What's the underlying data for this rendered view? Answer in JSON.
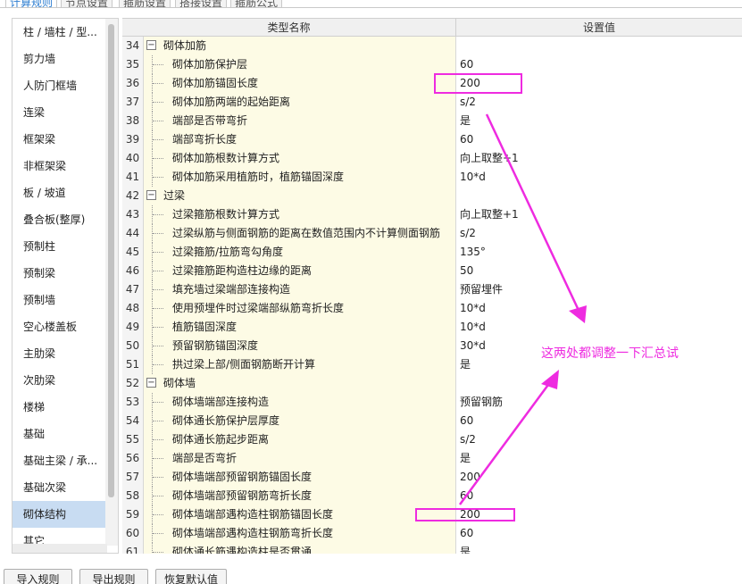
{
  "tabs": [
    {
      "label": "计算规则",
      "active": true
    },
    {
      "label": "节点设置",
      "active": false
    },
    {
      "label": "箍筋设置",
      "active": false
    },
    {
      "label": "搭接设置",
      "active": false
    },
    {
      "label": "箍筋公式",
      "active": false
    }
  ],
  "sidebar": {
    "items": [
      {
        "label": "柱 / 墙柱 / 型..."
      },
      {
        "label": "剪力墙"
      },
      {
        "label": "人防门框墙"
      },
      {
        "label": "连梁"
      },
      {
        "label": "框架梁"
      },
      {
        "label": "非框架梁"
      },
      {
        "label": "板 / 坡道"
      },
      {
        "label": "叠合板(整厚)"
      },
      {
        "label": "预制柱"
      },
      {
        "label": "预制梁"
      },
      {
        "label": "预制墙"
      },
      {
        "label": "空心楼盖板"
      },
      {
        "label": "主肋梁"
      },
      {
        "label": "次肋梁"
      },
      {
        "label": "楼梯"
      },
      {
        "label": "基础"
      },
      {
        "label": "基础主梁 / 承..."
      },
      {
        "label": "基础次梁"
      },
      {
        "label": "砌体结构",
        "selected": true
      },
      {
        "label": "其它"
      }
    ]
  },
  "grid": {
    "header": {
      "name": "类型名称",
      "value": "设置值"
    },
    "rows": [
      {
        "num": "34",
        "name": "砌体加筋",
        "value": "",
        "group": true,
        "toggle": "−"
      },
      {
        "num": "35",
        "name": "砌体加筋保护层",
        "value": "60"
      },
      {
        "num": "36",
        "name": "砌体加筋锚固长度",
        "value": "200"
      },
      {
        "num": "37",
        "name": "砌体加筋两端的起始距离",
        "value": "s/2"
      },
      {
        "num": "38",
        "name": "端部是否带弯折",
        "value": "是"
      },
      {
        "num": "39",
        "name": "端部弯折长度",
        "value": "60"
      },
      {
        "num": "40",
        "name": "砌体加筋根数计算方式",
        "value": "向上取整+1"
      },
      {
        "num": "41",
        "name": "砌体加筋采用植筋时，植筋锚固深度",
        "value": "10*d"
      },
      {
        "num": "42",
        "name": "过梁",
        "value": "",
        "group": true,
        "toggle": "−"
      },
      {
        "num": "43",
        "name": "过梁箍筋根数计算方式",
        "value": "向上取整+1"
      },
      {
        "num": "44",
        "name": "过梁纵筋与侧面钢筋的距离在数值范围内不计算侧面钢筋",
        "value": "s/2"
      },
      {
        "num": "45",
        "name": "过梁箍筋/拉筋弯勾角度",
        "value": "135°"
      },
      {
        "num": "46",
        "name": "过梁箍筋距构造柱边缘的距离",
        "value": "50"
      },
      {
        "num": "47",
        "name": "填充墙过梁端部连接构造",
        "value": "预留埋件"
      },
      {
        "num": "48",
        "name": "使用预埋件时过梁端部纵筋弯折长度",
        "value": "10*d"
      },
      {
        "num": "49",
        "name": "植筋锚固深度",
        "value": "10*d"
      },
      {
        "num": "50",
        "name": "预留钢筋锚固深度",
        "value": "30*d"
      },
      {
        "num": "51",
        "name": "拱过梁上部/侧面钢筋断开计算",
        "value": "是"
      },
      {
        "num": "52",
        "name": "砌体墙",
        "value": "",
        "group": true,
        "toggle": "−"
      },
      {
        "num": "53",
        "name": "砌体墙端部连接构造",
        "value": "预留钢筋"
      },
      {
        "num": "54",
        "name": "砌体通长筋保护层厚度",
        "value": "60"
      },
      {
        "num": "55",
        "name": "砌体通长筋起步距离",
        "value": "s/2"
      },
      {
        "num": "56",
        "name": "端部是否弯折",
        "value": "是"
      },
      {
        "num": "57",
        "name": "砌体墙端部预留钢筋锚固长度",
        "value": "200"
      },
      {
        "num": "58",
        "name": "砌体墙端部预留钢筋弯折长度",
        "value": "60"
      },
      {
        "num": "59",
        "name": "砌体墙端部遇构造柱钢筋锚固长度",
        "value": "200"
      },
      {
        "num": "60",
        "name": "砌体墙端部遇构造柱钢筋弯折长度",
        "value": "60"
      },
      {
        "num": "61",
        "name": "砌体通长筋遇构造柱是否贯通",
        "value": "是"
      }
    ]
  },
  "buttons": {
    "import": "导入规则",
    "export": "导出规则",
    "restore": "恢复默认值"
  },
  "annotation": {
    "text": "这两处都调整一下汇总试",
    "color": "#ee2be0"
  }
}
